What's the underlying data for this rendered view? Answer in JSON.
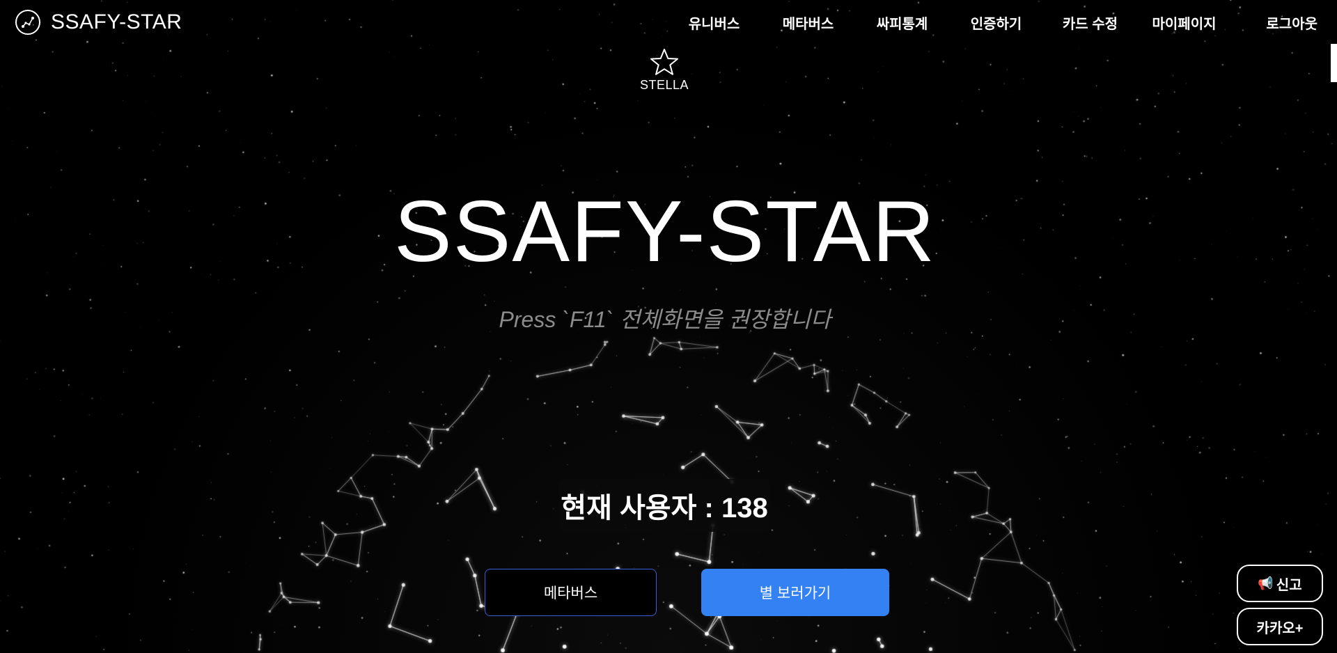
{
  "header": {
    "brand": "SSAFY-STAR",
    "nav": [
      "유니버스",
      "메타버스",
      "싸피통계",
      "인증하기",
      "카드 수정",
      "마이페이지",
      "로그아웃"
    ]
  },
  "stella": {
    "label": "STELLA"
  },
  "hero": {
    "title": "SSAFY-STAR",
    "subtitle": "Press `F11` 전체화면을 권장합니다",
    "user_count": "현재 사용자 : 138"
  },
  "buttons": {
    "metaverse": "메타버스",
    "view_stars": "별 보러가기"
  },
  "side": {
    "report": "신고",
    "kakao": "카카오+"
  },
  "colors": {
    "background": "#000000",
    "primary_button": "#3381f3",
    "outline_button_border": "#3b5fd6",
    "subtitle": "#8c8c8c"
  },
  "icons": {
    "brand": "constellation-logo-icon",
    "stella": "star-outline-icon",
    "report": "megaphone-icon"
  }
}
